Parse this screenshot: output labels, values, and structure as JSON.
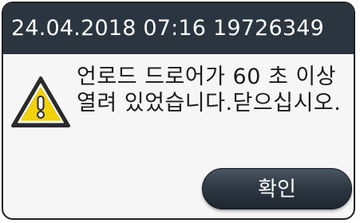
{
  "dialog": {
    "title": "24.04.2018 07:16 19726349",
    "message": "언로드 드로어가 60 초 이상 열려 있었습니다.닫으십시오.",
    "icon": "warning-icon",
    "confirm_label": "확인",
    "colors": {
      "title_bar": "#2b3540",
      "icon_fill": "#f2d20a",
      "button": "#2f3944"
    }
  }
}
